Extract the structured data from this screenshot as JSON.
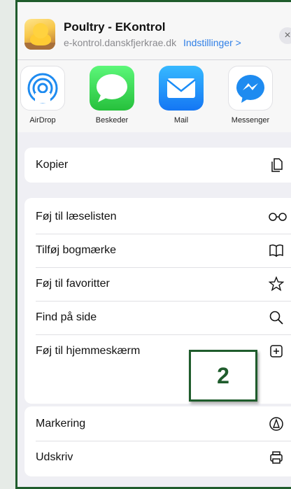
{
  "header": {
    "title": "Poultry - EKontrol",
    "url": "e-kontrol.danskfjerkrae.dk",
    "settings_link": "Indstillinger >",
    "close_glyph": "×"
  },
  "apps": [
    {
      "label": "AirDrop",
      "icon": "airdrop-icon"
    },
    {
      "label": "Beskeder",
      "icon": "messages-icon"
    },
    {
      "label": "Mail",
      "icon": "mail-icon"
    },
    {
      "label": "Messenger",
      "icon": "messenger-icon"
    }
  ],
  "actions": {
    "copy": "Kopier",
    "reading_list": "Føj til læselisten",
    "bookmark": "Tilføj bogmærke",
    "favorites": "Føj til favoritter",
    "find": "Find på side",
    "home_screen": "Føj til hjemmeskærm",
    "markup": "Markering",
    "print": "Udskriv"
  },
  "callout": {
    "number": "2"
  },
  "colors": {
    "accent_link": "#2f7fe6",
    "callout_border": "#1f5c2c"
  }
}
